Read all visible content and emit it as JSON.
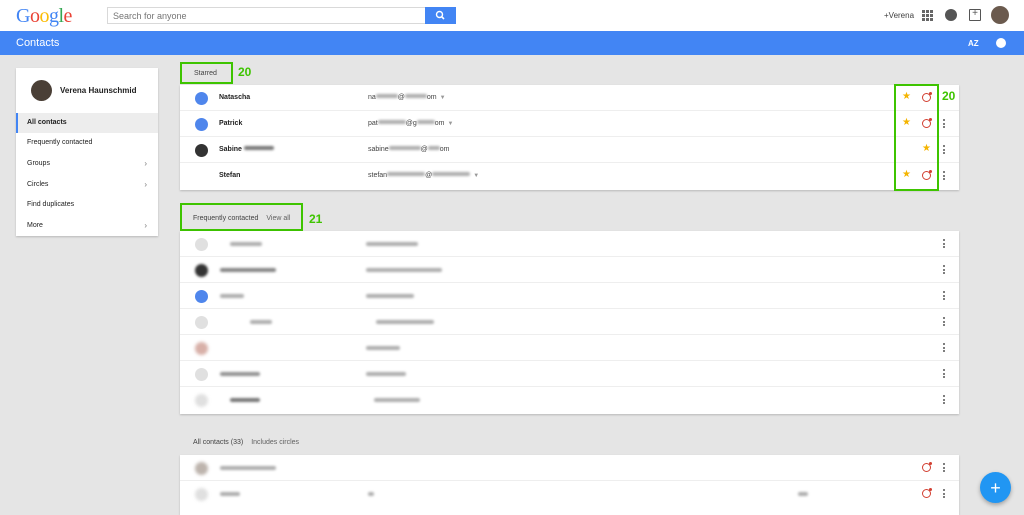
{
  "topbar": {
    "logo": "Google",
    "search_placeholder": "Search for anyone",
    "user_link": "+Verena"
  },
  "appbar": {
    "title": "Contacts",
    "sort_label": "AZ"
  },
  "sidebar": {
    "user_name": "Verena Haunschmid",
    "items": [
      {
        "label": "All contacts"
      },
      {
        "label": "Frequently contacted"
      },
      {
        "label": "Groups",
        "chevron": "›"
      },
      {
        "label": "Circles",
        "chevron": "›"
      },
      {
        "label": "Find duplicates"
      },
      {
        "label": "More",
        "chevron": "›"
      }
    ]
  },
  "starred": {
    "header": "Starred",
    "annotation_header": "20",
    "annotation_icons": "20",
    "rows": [
      {
        "name": "Natascha",
        "email_start": "na",
        "email_mid": "@",
        "email_end": "om"
      },
      {
        "name": "Patrick",
        "email_start": "pat",
        "email_mid": "@g",
        "email_end": "om"
      },
      {
        "name": "Sabine",
        "email_start": "sabine",
        "email_mid": "@",
        "email_end": "om"
      },
      {
        "name": "Stefan",
        "email_start": "stefan",
        "email_mid": "@",
        "email_end": ""
      }
    ]
  },
  "frequent": {
    "header": "Frequently contacted",
    "view_all": "View all",
    "annotation": "21"
  },
  "all_contacts": {
    "header": "All contacts (33)",
    "sub": "Includes circles"
  },
  "fab_label": "+",
  "colors": {
    "accent_blue": "#4285f4",
    "highlight_green": "#3ec400",
    "star_yellow": "#f4b400",
    "gplus_red": "#d23f31"
  }
}
